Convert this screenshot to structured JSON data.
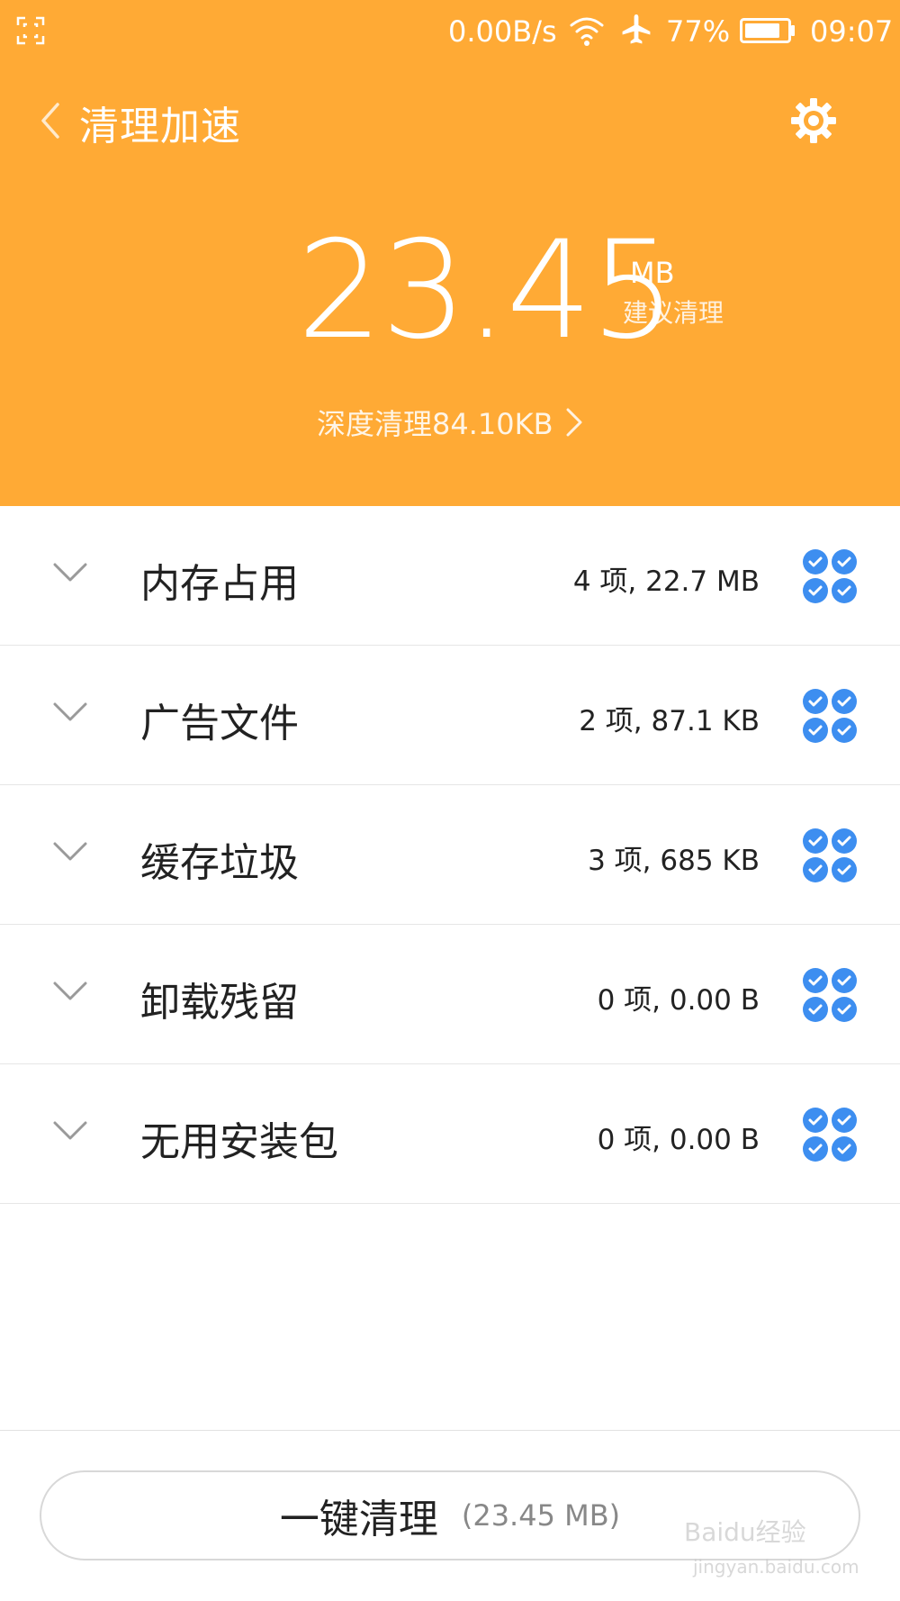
{
  "status_bar": {
    "net_speed": "0.00B/s",
    "battery_pct": "77%",
    "time": "09:07"
  },
  "title_bar": {
    "title": "清理加速"
  },
  "summary": {
    "size_value": "23.45",
    "size_unit": "MB",
    "size_caption": "建议清理",
    "deep_clean_label": "深度清理84.10KB"
  },
  "items": [
    {
      "label": "内存占用",
      "meta": "4 项, 22.7 MB"
    },
    {
      "label": "广告文件",
      "meta": "2 项, 87.1 KB"
    },
    {
      "label": "缓存垃圾",
      "meta": "3 项, 685 KB"
    },
    {
      "label": "卸载残留",
      "meta": "0 项, 0.00 B"
    },
    {
      "label": "无用安装包",
      "meta": "0 项, 0.00 B"
    }
  ],
  "action": {
    "label": "一键清理",
    "size": "(23.45 MB)"
  },
  "watermark": {
    "text": "Baidu经验",
    "sub": "jingyan.baidu.com"
  },
  "colors": {
    "header_bg": "#FFAA35",
    "check_blue": "#3D8EF0"
  }
}
